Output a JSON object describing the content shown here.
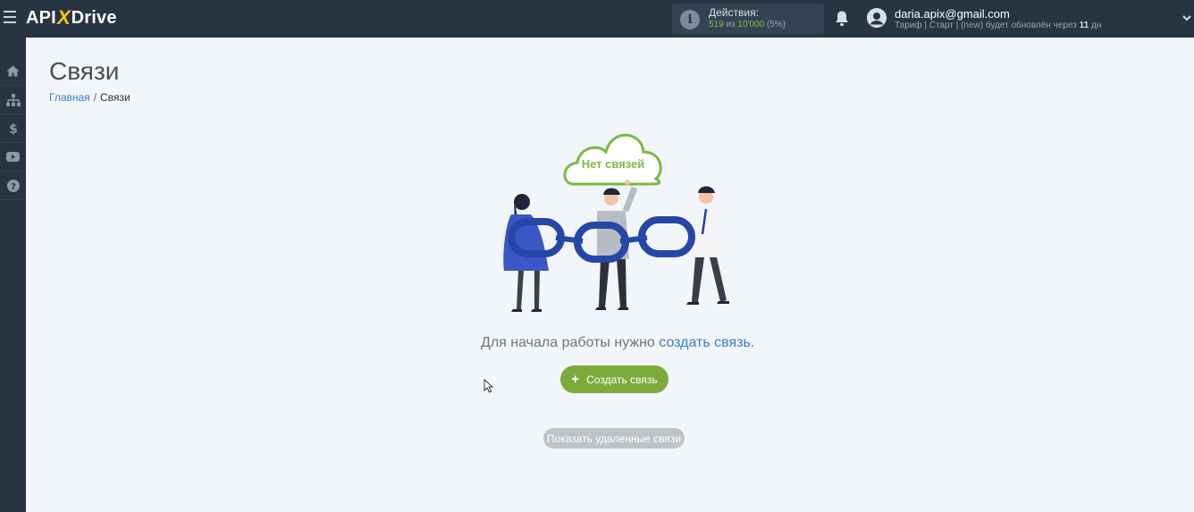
{
  "header": {
    "logo": {
      "left": "API",
      "x": "X",
      "right": "Drive"
    },
    "actions": {
      "title": "Действия:",
      "used": "519",
      "middle": " из ",
      "total": "10'000",
      "percent": " (5%)"
    },
    "user": {
      "email": "daria.apix@gmail.com",
      "plan_prefix": "Тариф | Старт | (new) будет обновлён через ",
      "plan_days": "11",
      "plan_suffix": " дн"
    }
  },
  "sidebar": {
    "items": [
      {
        "icon": "home-icon"
      },
      {
        "icon": "sitemap-icon"
      },
      {
        "icon": "dollar-icon"
      },
      {
        "icon": "youtube-icon"
      },
      {
        "icon": "help-icon"
      }
    ]
  },
  "page": {
    "title": "Связи",
    "breadcrumb": {
      "home": "Главная",
      "separator": "/",
      "current": "Связи"
    }
  },
  "empty_state": {
    "cloud_label": "Нет связей",
    "message_prefix": "Для начала работы нужно ",
    "message_link": "создать связь",
    "message_suffix": ".",
    "create_button": "Создать связь",
    "create_button_icon": "+",
    "show_deleted_button": "Показать удаленные связи"
  },
  "colors": {
    "topbar": "#273442",
    "accent_green": "#7cab3c",
    "link_blue": "#3d7cc9",
    "logo_x": "#f7c21a"
  }
}
